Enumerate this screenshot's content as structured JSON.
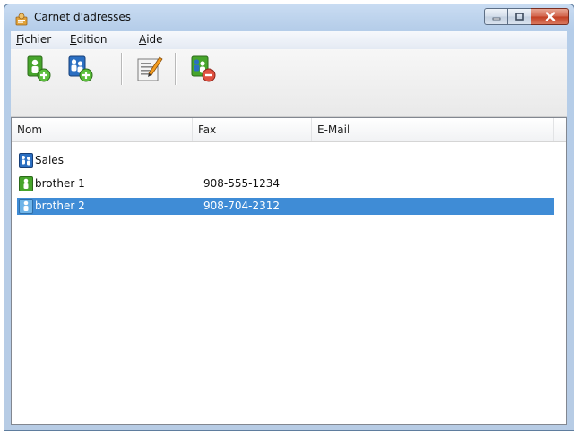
{
  "window": {
    "title": "Carnet d'adresses",
    "controls": {
      "minimize": "minimize-icon",
      "maximize": "maximize-icon",
      "close": "close-icon"
    }
  },
  "menu": {
    "items": [
      {
        "label": "Fichier",
        "mnemonic": "F",
        "rest": "ichier"
      },
      {
        "label": "Edition",
        "mnemonic": "E",
        "rest": "dition"
      },
      {
        "label": "Aide",
        "mnemonic": "A",
        "rest": "ide"
      }
    ]
  },
  "toolbar": {
    "buttons": [
      {
        "icon": "add-member-icon"
      },
      {
        "icon": "add-group-icon"
      },
      {
        "icon": "edit-icon"
      },
      {
        "icon": "delete-icon"
      }
    ]
  },
  "list": {
    "columns": [
      "Nom",
      "Fax",
      "E-Mail"
    ],
    "rows": [
      {
        "icon": "group-icon",
        "name": "Sales",
        "fax": "",
        "email": "",
        "selected": false
      },
      {
        "icon": "person-icon",
        "name": "brother 1",
        "fax": "908-555-1234",
        "email": "",
        "selected": false
      },
      {
        "icon": "person-icon",
        "name": "brother 2",
        "fax": "908-704-2312",
        "email": "",
        "selected": true
      }
    ]
  },
  "colors": {
    "selection": "#3f8cd6",
    "icon_green": "#47a52c",
    "icon_blue": "#2b6fc2",
    "close_red": "#c23e22"
  }
}
